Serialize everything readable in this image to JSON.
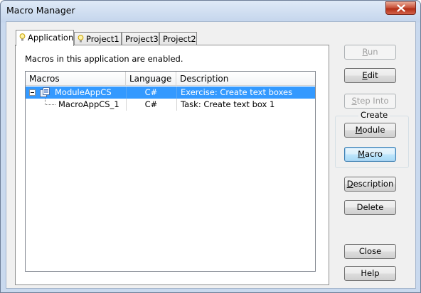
{
  "window": {
    "title": "Macro Manager"
  },
  "tabs": [
    {
      "label": "Application",
      "icon": "lightbulb-icon",
      "active": true
    },
    {
      "label": "Project1",
      "icon": "lightbulb-icon",
      "active": false
    },
    {
      "label": "Project3",
      "icon": "",
      "active": false
    },
    {
      "label": "Project2",
      "icon": "",
      "active": false
    }
  ],
  "panel": {
    "status_text": "Macros in this application are enabled."
  },
  "tree": {
    "columns": [
      "Macros",
      "Language",
      "Description"
    ],
    "rows": [
      {
        "name": "ModuleAppCS",
        "language": "C#",
        "description": "Exercise: Create text boxes",
        "selected": true,
        "icon": "module-icon"
      },
      {
        "name": "MacroAppCS_1",
        "language": "C#",
        "description": "Task: Create text box 1",
        "selected": false
      }
    ]
  },
  "buttons": {
    "run": {
      "mnemonic": "R",
      "rest": "un"
    },
    "edit": {
      "mnemonic": "E",
      "rest": "dit"
    },
    "step_into": {
      "mnemonic": "S",
      "rest": "tep Into"
    },
    "create_group": "Create",
    "module": {
      "mnemonic": "M",
      "rest": "odule"
    },
    "macro": {
      "mnemonic": "M",
      "rest": "acro"
    },
    "description": {
      "mnemonic": "D",
      "rest": "escription"
    },
    "delete": "Delete",
    "close": "Close",
    "help": "Help"
  },
  "colors": {
    "selection": "#3399ff",
    "close_button": "#c9543d"
  }
}
